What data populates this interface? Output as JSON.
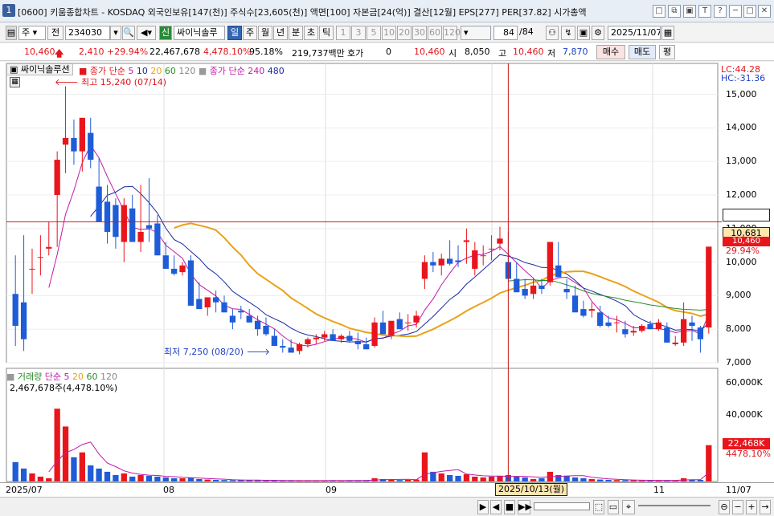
{
  "window": {
    "number": "1",
    "title": "[0600] 키움종합차트 - KOSDAQ 외국인보유[147(천)] 주식수[23,605(천)] 액면[100] 자본금[24(억)] 결산[12월] EPS[277] PER[37.82] 시가총액",
    "controls": [
      "□",
      "⧉",
      "▣",
      "T",
      "?",
      "─",
      "□",
      "✕"
    ]
  },
  "toolbar": {
    "mode": "주",
    "prev_label": "전",
    "code": "234030",
    "sin_label": "신",
    "stock_name": "싸이닉솔루",
    "periods": [
      "일",
      "주",
      "월",
      "년",
      "분",
      "초",
      "틱"
    ],
    "selected_period": "일",
    "intervals": [
      "1",
      "3",
      "5",
      "10",
      "20",
      "30",
      "60",
      "120"
    ],
    "count": "84",
    "count_total": "/84",
    "date": "2025/11/07"
  },
  "quote": {
    "price": "10,460",
    "change": "2,410",
    "change_pct": "+29.94%",
    "volume": "22,467,678",
    "volume_pct": "4,478.10%",
    "turnover": "95.18%",
    "amount": "219,737백만",
    "hoga_label": "호가",
    "hoga_value": "0",
    "hoga_price": "10,460",
    "open_label": "시",
    "open": "8,050",
    "high_label": "고",
    "high": "10,460",
    "low_label": "저",
    "low": "7,870",
    "buy_label": "매수",
    "sell_label": "매도",
    "eval_label": "평"
  },
  "legend": {
    "stock_name": "싸이닉솔루션",
    "ma_prefix": "종가 단순",
    "ma_periods": [
      "5",
      "10",
      "20",
      "60",
      "120"
    ],
    "ma2_prefix": "종가 단순",
    "ma2_periods": [
      "240",
      "480"
    ],
    "lc": "LC:44.28",
    "hc": "HC:-31.36",
    "high_annotation": "최고 15,240 (07/14)",
    "low_annotation": "최저 7,250 (08/20)",
    "vol_legend_prefix": "거래량",
    "vol_ma_prefix": "단순",
    "vol_ma_periods": [
      "5",
      "20",
      "60",
      "120"
    ],
    "vol_value": "2,467,678주(4,478.10%)"
  },
  "colors": {
    "up": "#e8161c",
    "down": "#1e5cd8",
    "ma5": "#c21aa8",
    "ma10": "#1a2a9c",
    "ma20": "#e8a21a",
    "ma60": "#2a8a2a",
    "crosshair": "#c81818"
  },
  "y_axis": {
    "ticks": [
      "15,000",
      "14,000",
      "13,000",
      "12,000",
      "11,000",
      "10,000",
      "9,000",
      "8,000",
      "7,000"
    ],
    "cursor_value": "10,681",
    "price_tag": "10,460",
    "pct_tag": "29.94%"
  },
  "vol_axis": {
    "ticks": [
      "60,000K",
      "40,000K"
    ],
    "last_value": "22,468K",
    "last_pct": "4478.10%"
  },
  "x_axis": {
    "labels": [
      "2025/07",
      "08",
      "09",
      "11",
      "11/07"
    ],
    "cursor_label": "2025/10/13(월)"
  },
  "chart_data": {
    "type": "candlestick",
    "ylim": [
      7000,
      15300
    ],
    "vol_ylim": [
      0,
      65000
    ],
    "crosshair": {
      "x_index": 59,
      "y": 11200
    },
    "candles": [
      [
        9050,
        10200,
        7500,
        8100,
        12000
      ],
      [
        8800,
        10800,
        7350,
        7700,
        8000
      ],
      [
        9800,
        10400,
        9050,
        9800,
        5000
      ],
      [
        10150,
        10800,
        9600,
        10150,
        3000
      ],
      [
        10400,
        11200,
        10200,
        10450,
        2000
      ],
      [
        12000,
        13300,
        10450,
        13050,
        45000
      ],
      [
        13500,
        15240,
        12650,
        13700,
        34000
      ],
      [
        13700,
        14250,
        12900,
        13300,
        15000
      ],
      [
        13300,
        14300,
        12700,
        14300,
        18000
      ],
      [
        13850,
        14300,
        12800,
        13050,
        10000
      ],
      [
        12250,
        13100,
        11500,
        11200,
        8000
      ],
      [
        11800,
        12300,
        10550,
        10900,
        6000
      ],
      [
        11700,
        11900,
        10400,
        10750,
        4000
      ],
      [
        10600,
        11900,
        10000,
        11700,
        5000
      ],
      [
        11600,
        12000,
        10900,
        10600,
        3000
      ],
      [
        10600,
        12300,
        10300,
        10900,
        4000
      ],
      [
        11100,
        12500,
        10600,
        11000,
        3500
      ],
      [
        11150,
        11400,
        10200,
        10200,
        3000
      ],
      [
        10200,
        10600,
        9800,
        9800,
        2500
      ],
      [
        9800,
        10200,
        9600,
        9650,
        2000
      ],
      [
        9700,
        10000,
        9600,
        9900,
        2000
      ],
      [
        10050,
        10200,
        9550,
        8700,
        2500
      ],
      [
        8900,
        9400,
        8600,
        8600,
        1500
      ],
      [
        8650,
        8900,
        8400,
        8950,
        1200
      ],
      [
        8950,
        9150,
        8500,
        8800,
        1000
      ],
      [
        8800,
        9000,
        8600,
        8500,
        900
      ],
      [
        8400,
        8600,
        8000,
        8200,
        800
      ],
      [
        8550,
        8700,
        8300,
        8500,
        900
      ],
      [
        8400,
        8600,
        8200,
        8200,
        800
      ],
      [
        8250,
        8400,
        7800,
        8000,
        700
      ],
      [
        8100,
        8350,
        7800,
        7850,
        600
      ],
      [
        7800,
        8000,
        7500,
        7500,
        600
      ],
      [
        7500,
        7700,
        7300,
        7450,
        500
      ],
      [
        7450,
        7700,
        7300,
        7300,
        500
      ],
      [
        7350,
        7600,
        7250,
        7550,
        600
      ],
      [
        7550,
        7750,
        7450,
        7700,
        500
      ],
      [
        7700,
        7850,
        7550,
        7750,
        600
      ],
      [
        7750,
        7950,
        7650,
        7850,
        500
      ],
      [
        7850,
        8000,
        7700,
        7650,
        700
      ],
      [
        7700,
        7850,
        7600,
        7800,
        500
      ],
      [
        7800,
        7950,
        7600,
        7650,
        600
      ],
      [
        7650,
        7900,
        7400,
        7550,
        700
      ],
      [
        7550,
        7750,
        7400,
        7400,
        800
      ],
      [
        7500,
        8350,
        7450,
        8200,
        2000
      ],
      [
        8200,
        8550,
        8050,
        7850,
        1500
      ],
      [
        7800,
        8150,
        7700,
        8250,
        1200
      ],
      [
        8300,
        8500,
        8100,
        8000,
        900
      ],
      [
        8200,
        8450,
        7950,
        8200,
        1000
      ],
      [
        8200,
        8550,
        8050,
        8400,
        1200
      ],
      [
        9500,
        10200,
        9200,
        10000,
        18000
      ],
      [
        10000,
        10300,
        9700,
        9900,
        6000
      ],
      [
        9900,
        10250,
        9600,
        10100,
        5000
      ],
      [
        10100,
        10650,
        9900,
        9950,
        4000
      ],
      [
        10050,
        10500,
        9850,
        10000,
        3500
      ],
      [
        10600,
        11000,
        9950,
        10650,
        4500
      ],
      [
        9800,
        10600,
        9600,
        10350,
        3000
      ],
      [
        10200,
        10500,
        9900,
        10200,
        2500
      ],
      [
        10400,
        10800,
        10050,
        10400,
        3000
      ],
      [
        10550,
        11050,
        10350,
        10700,
        3500
      ],
      [
        10000,
        10900,
        9800,
        9500,
        4000
      ],
      [
        9500,
        10000,
        9200,
        9100,
        3000
      ],
      [
        9200,
        9500,
        8900,
        9000,
        2500
      ],
      [
        9050,
        9500,
        8900,
        9300,
        1500
      ],
      [
        9300,
        9500,
        9050,
        9200,
        2000
      ],
      [
        9400,
        10500,
        9300,
        10600,
        6000
      ],
      [
        9900,
        10600,
        9600,
        9550,
        4000
      ],
      [
        9200,
        9500,
        8900,
        9100,
        3500
      ],
      [
        9000,
        9300,
        8600,
        8500,
        2500
      ],
      [
        8600,
        8850,
        8350,
        8400,
        2000
      ],
      [
        8550,
        8800,
        8350,
        8600,
        1500
      ],
      [
        8500,
        8700,
        8050,
        8100,
        1200
      ],
      [
        8200,
        8400,
        8050,
        8100,
        1000
      ],
      [
        8200,
        8400,
        7900,
        8200,
        900
      ],
      [
        8000,
        8250,
        7750,
        7850,
        800
      ],
      [
        7900,
        8100,
        7800,
        7950,
        700
      ],
      [
        7950,
        8150,
        7900,
        8100,
        600
      ],
      [
        8150,
        8250,
        8000,
        8000,
        600
      ],
      [
        8000,
        8300,
        7950,
        8200,
        700
      ],
      [
        8050,
        8200,
        7900,
        7600,
        800
      ],
      [
        7550,
        7800,
        7500,
        7600,
        700
      ],
      [
        7600,
        8800,
        7500,
        8300,
        2000
      ],
      [
        8200,
        8400,
        7650,
        8100,
        1200
      ],
      [
        8050,
        8100,
        7300,
        7700,
        1000
      ],
      [
        8050,
        10460,
        7870,
        10460,
        22468
      ]
    ]
  }
}
